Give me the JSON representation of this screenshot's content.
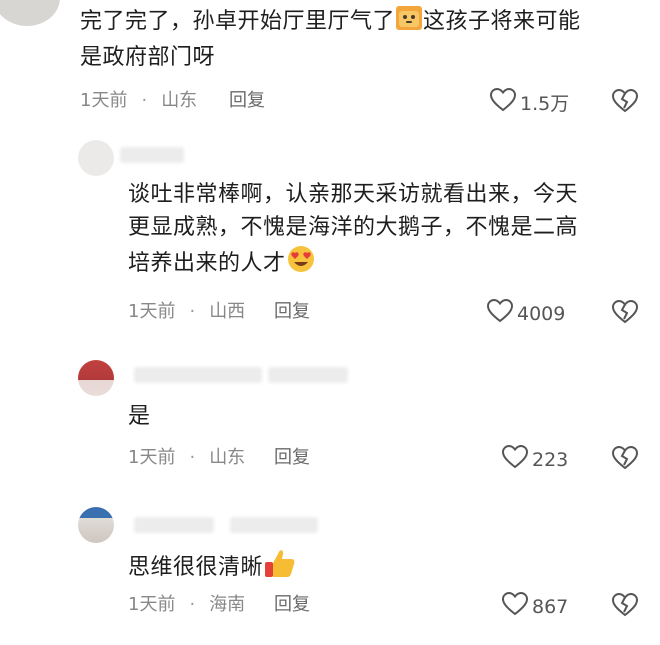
{
  "comments": [
    {
      "text_line1": "完了完了，孙卓开始厅里厅气了",
      "text_line1b": "这孩子将来可能",
      "text_line2": "是政府部门呀",
      "time": "1天前",
      "location": "山东",
      "reply": "回复",
      "likes": "1.5万"
    },
    {
      "text_line1": "谈吐非常棒啊，认亲那天采访就看出来，今天",
      "text_line2": "更显成熟，不愧是海洋的大鹅子，不愧是二高",
      "text_line3": "培养出来的人才",
      "time": "1天前",
      "location": "山西",
      "reply": "回复",
      "likes": "4009"
    },
    {
      "text_line1": "是",
      "time": "1天前",
      "location": "山东",
      "reply": "回复",
      "likes": "223"
    },
    {
      "text_line1": "思维很很清晰",
      "time": "1天前",
      "location": "海南",
      "reply": "回复",
      "likes": "867"
    }
  ],
  "icons": {
    "like": "heart-icon",
    "dislike": "broken-heart-icon",
    "emoji_1": "cat-emoji-icon",
    "emoji_2": "heart-eyes-emoji-icon",
    "emoji_3": "thumbs-up-emoji-icon"
  },
  "colors": {
    "meta": "#888888",
    "icon": "#555555"
  }
}
